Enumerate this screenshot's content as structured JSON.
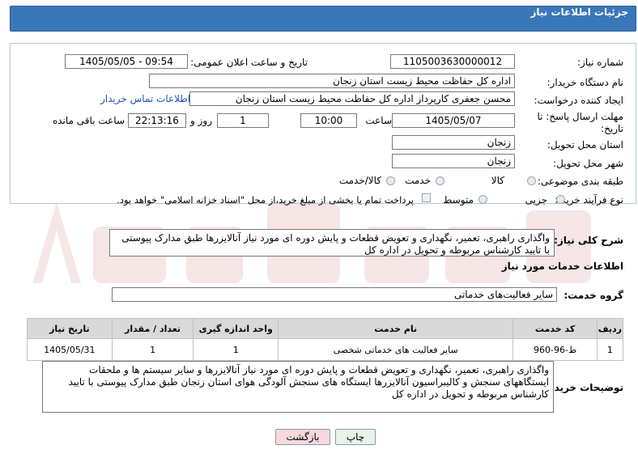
{
  "header": {
    "title": "جزئیات اطلاعات نیاز"
  },
  "form": {
    "need_number_label": "شماره نیاز:",
    "need_number": "1105003630000012",
    "announce_label": "تاریخ و ساعت اعلان عمومی:",
    "announce_value": "1405/05/05 - 09:54",
    "buyer_org_label": "نام دستگاه خریدار:",
    "buyer_org": "اداره کل حفاظت محیط زیست استان زنجان",
    "requester_label": "ایجاد کننده درخواست:",
    "requester": "محسن جعفری کارپرداز اداره کل حفاظت محیط زیست استان زنجان",
    "contact_link": "اطلاعات تماس خریدار",
    "deadline_label_1": "مهلت ارسال پاسخ: تا",
    "deadline_label_2": "تاریخ:",
    "deadline_date": "1405/05/07",
    "time_label": "ساعت",
    "deadline_time": "10:00",
    "days_value": "1",
    "days_label": "روز و",
    "remaining_time": "22:13:16",
    "remaining_label": "ساعت باقی مانده",
    "province_label": "استان محل تحویل:",
    "province": "زنجان",
    "city_label": "شهر محل تحویل:",
    "city": "زنجان",
    "category_label": "طبقه بندی موضوعی:",
    "category_options": [
      "کالا",
      "خدمت",
      "کالا/خدمت"
    ],
    "process_label": "نوع فرآیند خرید :",
    "process_options": [
      "جزیی",
      "متوسط"
    ],
    "payment_note": "پرداخت تمام یا بخشی از مبلغ خرید،از محل \"اسناد خزانه اسلامی\" خواهد بود."
  },
  "summary": {
    "label": "شرح کلی نیاز:",
    "text": "واگذاری راهبری، تعمیر، نگهداری و تعویض قطعات و پایش دوره ای مورد نیاز آنالایزرها طبق مدارک پیوستی با تایید کارشناس مربوطه و تحویل در اداره کل"
  },
  "services": {
    "section_title": "اطلاعات خدمات مورد نیاز",
    "group_label": "گروه خدمت:",
    "group_value": "سایر فعالیت‌های خدماتی",
    "columns": [
      "ردیف",
      "کد خدمت",
      "نام خدمت",
      "واحد اندازه گیری",
      "تعداد / مقدار",
      "تاریخ نیاز"
    ],
    "rows": [
      [
        "1",
        "ط-96-960",
        "سایر فعالیت های خدماتی شخصی",
        "1",
        "1",
        "1405/05/31"
      ]
    ]
  },
  "buyer_notes": {
    "label": "توضیحات خریدار:",
    "text": "واگذاری راهبری، تعمیر، نگهداری و تعویض قطعات و پایش دوره ای مورد نیاز آنالایزرها و سایر سیستم ها و ملحقات ایستگاههای سنجش و کالیبراسیون آنالایزرها ایستگاه های سنجش آلودگی هوای استان زنجان طبق مدارک پیوستی با تایید کارشناس مربوطه و تحویل در اداره کل"
  },
  "buttons": {
    "print": "چاپ",
    "back": "بازگشت"
  },
  "colors": {
    "header": "#3a77b8",
    "back_button": "#f7d9dc",
    "print_button": "#e9f3e6",
    "link": "#1a56b0"
  }
}
